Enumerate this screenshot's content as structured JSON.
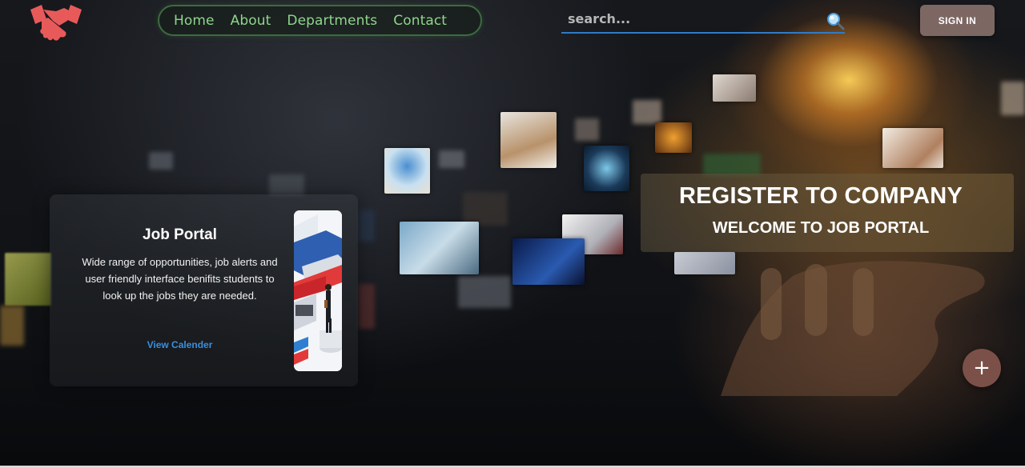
{
  "header": {
    "logo_icon": "handshake-icon",
    "nav": [
      {
        "label": "Home"
      },
      {
        "label": "About"
      },
      {
        "label": "Departments"
      },
      {
        "label": "Contact"
      }
    ],
    "search": {
      "placeholder": "search...",
      "icon": "search-icon"
    },
    "signin_label": "SIGN IN"
  },
  "card": {
    "title": "Job Portal",
    "text": "Wide range of opportunities, job alerts and user friendly interface benifits students to look up the jobs they are needed.",
    "link": "View Calender"
  },
  "hero": {
    "title": "REGISTER TO COMPANY",
    "subtitle": "WELCOME TO JOB PORTAL"
  },
  "fab": {
    "label": "+",
    "icon": "plus-icon"
  },
  "colors": {
    "logo": "#e85a5a",
    "nav_text": "#8fd58c",
    "search_underline": "#2f7bc7",
    "signin_bg": "#7d6763",
    "link": "#3a8fe0",
    "fab_bg": "#7a5048"
  }
}
